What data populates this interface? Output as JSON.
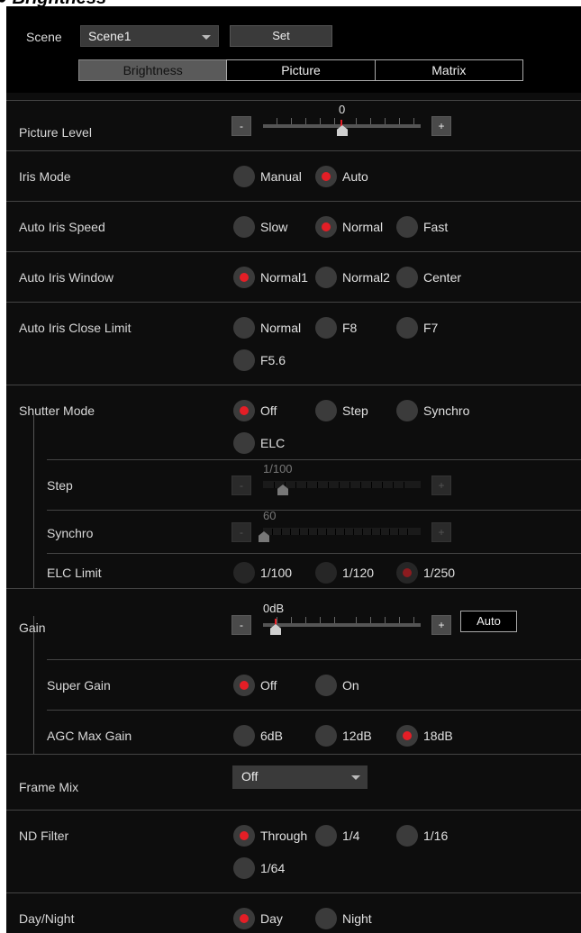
{
  "header": {
    "title": "Brightness"
  },
  "scene": {
    "label": "Scene",
    "value": "Scene1",
    "set_label": "Set"
  },
  "tabs": [
    {
      "label": "Brightness",
      "active": true
    },
    {
      "label": "Picture",
      "active": false
    },
    {
      "label": "Matrix",
      "active": false
    }
  ],
  "picture_level": {
    "label": "Picture Level",
    "value": "0",
    "minus": "-",
    "plus": "+"
  },
  "iris_mode": {
    "label": "Iris Mode",
    "options": [
      "Manual",
      "Auto"
    ],
    "selected": "Auto"
  },
  "auto_iris_speed": {
    "label": "Auto Iris Speed",
    "options": [
      "Slow",
      "Normal",
      "Fast"
    ],
    "selected": "Normal"
  },
  "auto_iris_window": {
    "label": "Auto Iris Window",
    "options": [
      "Normal1",
      "Normal2",
      "Center"
    ],
    "selected": "Normal1"
  },
  "auto_iris_close_limit": {
    "label": "Auto Iris Close Limit",
    "options": [
      "Normal",
      "F8",
      "F7",
      "F5.6"
    ],
    "selected": ""
  },
  "shutter_mode": {
    "label": "Shutter Mode",
    "options": [
      "Off",
      "Step",
      "Synchro",
      "ELC"
    ],
    "selected": "Off"
  },
  "step": {
    "label": "Step",
    "value": "1/100",
    "minus": "-",
    "plus": "+"
  },
  "synchro": {
    "label": "Synchro",
    "value": "60",
    "minus": "-",
    "plus": "+"
  },
  "elc_limit": {
    "label": "ELC Limit",
    "options": [
      "1/100",
      "1/120",
      "1/250"
    ],
    "selected": "1/250"
  },
  "gain": {
    "label": "Gain",
    "value": "0dB",
    "minus": "-",
    "plus": "+",
    "auto_label": "Auto"
  },
  "super_gain": {
    "label": "Super Gain",
    "options": [
      "Off",
      "On"
    ],
    "selected": "Off"
  },
  "agc_max_gain": {
    "label": "AGC Max Gain",
    "options": [
      "6dB",
      "12dB",
      "18dB"
    ],
    "selected": "18dB"
  },
  "frame_mix": {
    "label": "Frame Mix",
    "value": "Off"
  },
  "nd_filter": {
    "label": "ND Filter",
    "options": [
      "Through",
      "1/4",
      "1/16",
      "1/64"
    ],
    "selected": "Through"
  },
  "day_night": {
    "label": "Day/Night",
    "options": [
      "Day",
      "Night"
    ],
    "selected": "Day"
  },
  "colors": {
    "background": "#0d0d0d",
    "accent": "#e41e26",
    "control": "#3b3b3b"
  }
}
